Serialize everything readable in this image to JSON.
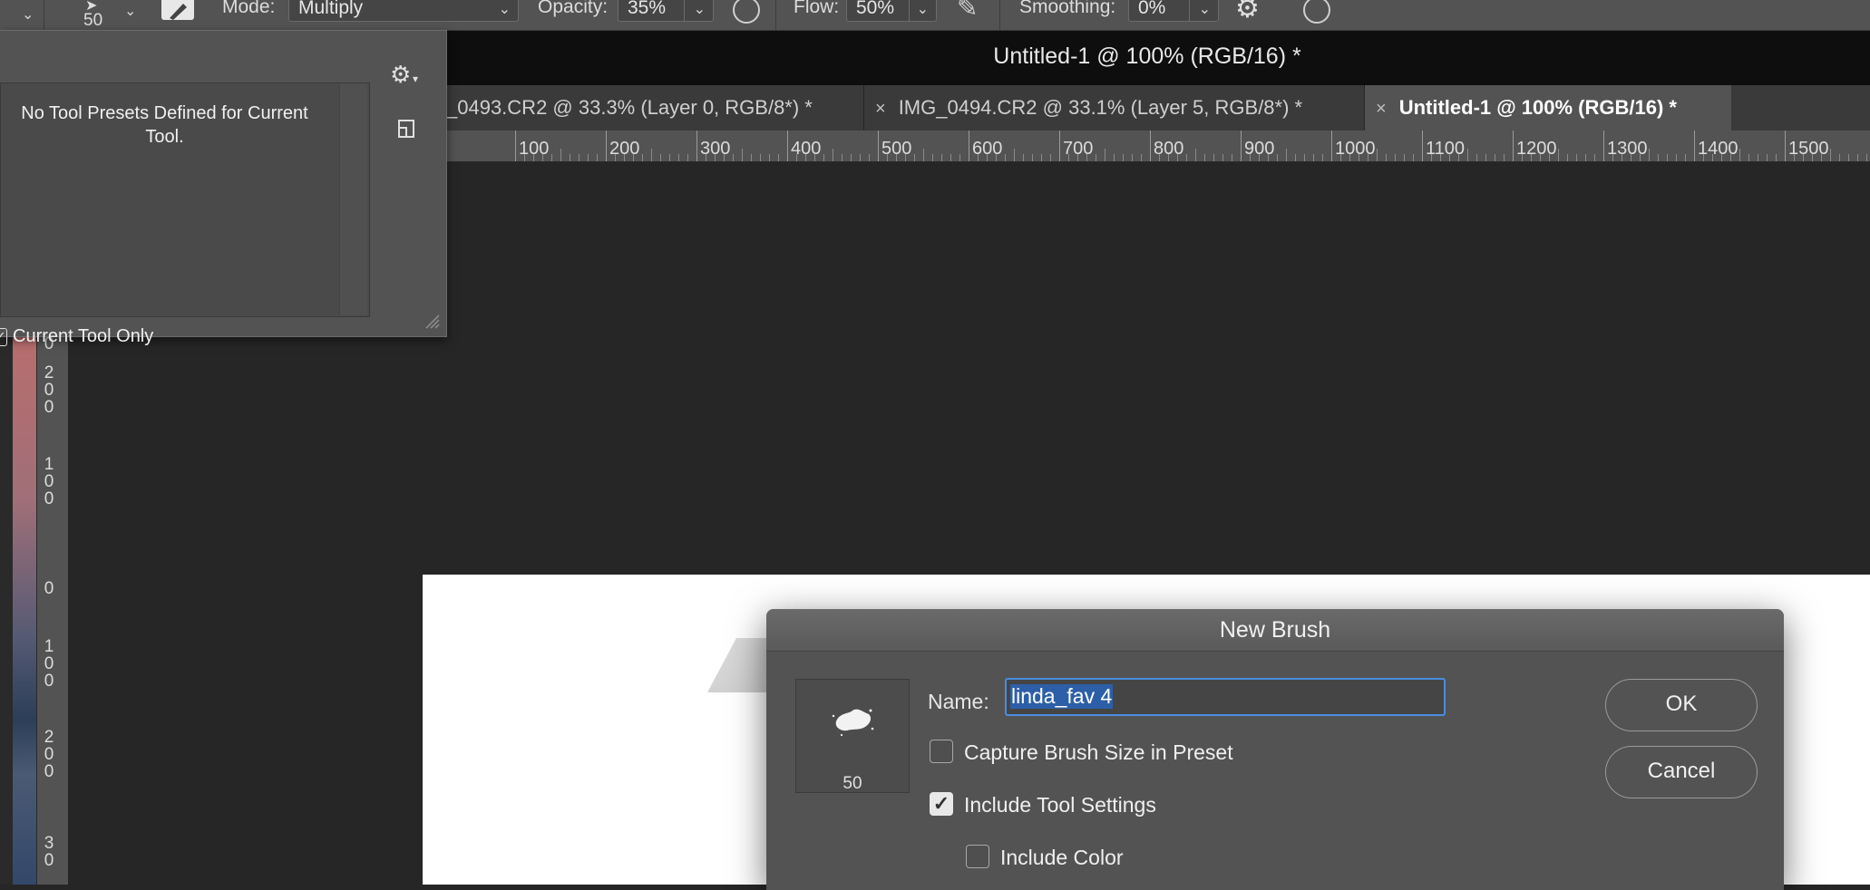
{
  "options_bar": {
    "brush_size": "50",
    "mode_label": "Mode:",
    "mode_value": "Multiply",
    "opacity_label": "Opacity:",
    "opacity_value": "35%",
    "flow_label": "Flow:",
    "flow_value": "50%",
    "smoothing_label": "Smoothing:",
    "smoothing_value": "0%"
  },
  "window": {
    "title": "Untitled-1 @ 100% (RGB/16) *"
  },
  "tabs": [
    {
      "label": "_0493.CR2 @ 33.3% (Layer 0, RGB/8*) *",
      "active": false
    },
    {
      "label": "IMG_0494.CR2 @ 33.1% (Layer 5, RGB/8*) *",
      "active": false
    },
    {
      "label": "Untitled-1 @ 100% (RGB/16) *",
      "active": true
    }
  ],
  "tab_close_glyph": "×",
  "h_ruler": {
    "labels": [
      "100",
      "200",
      "300",
      "400",
      "500",
      "600",
      "700",
      "800",
      "900",
      "1000",
      "1100",
      "1200",
      "1300",
      "1400",
      "1500"
    ]
  },
  "v_ruler": {
    "labels": [
      [
        "0"
      ],
      [
        "2",
        "0",
        "0"
      ],
      [
        "1",
        "0",
        "0"
      ],
      [
        "0"
      ],
      [
        "1",
        "0",
        "0"
      ],
      [
        "2",
        "0",
        "0"
      ],
      [
        "3",
        "0"
      ]
    ]
  },
  "presets_panel": {
    "empty_message": "No Tool Presets Defined for Current Tool.",
    "current_tool_only_label": "Current Tool Only",
    "current_tool_only_checked": true
  },
  "new_brush_dialog": {
    "title": "New Brush",
    "brush_preview_size": "50",
    "name_label": "Name:",
    "name_value": "linda_fav 4",
    "ok_label": "OK",
    "cancel_label": "Cancel",
    "options": [
      {
        "label": "Capture Brush Size in Preset",
        "checked": false
      },
      {
        "label": "Include Tool Settings",
        "checked": true
      },
      {
        "label": "Include Color",
        "checked": false
      }
    ]
  },
  "colors": {
    "panel_bg": "#535353",
    "canvas_bg": "#262626",
    "title_bar_bg": "#0e0e0e",
    "focus_ring": "#4a8de0",
    "selection": "#2d5fa8"
  }
}
